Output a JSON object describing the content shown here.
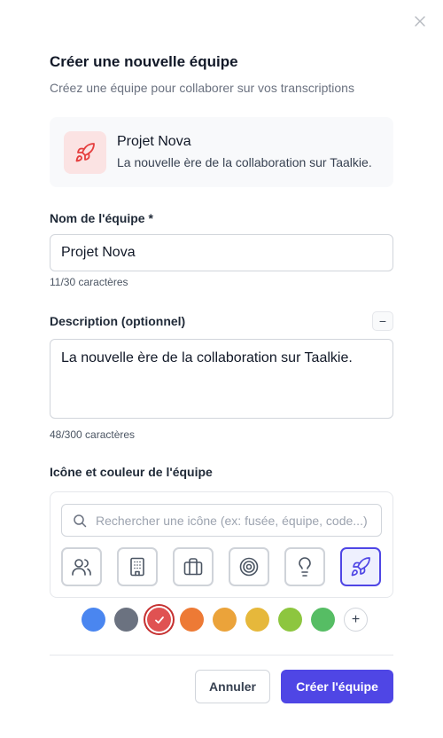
{
  "dialog": {
    "title": "Créer une nouvelle équipe",
    "subtitle": "Créez une équipe pour collaborer sur vos transcriptions"
  },
  "preview": {
    "name": "Projet Nova",
    "description": "La nouvelle ère de la collaboration sur Taalkie.",
    "icon": "rocket-icon",
    "icon_color": "#e53e3e",
    "icon_bg": "#fbe3e3"
  },
  "name_field": {
    "label": "Nom de l'équipe *",
    "value": "Projet Nova",
    "counter": "11/30 caractères"
  },
  "description_field": {
    "label": "Description (optionnel)",
    "collapse_label": "−",
    "value": "La nouvelle ère de la collaboration sur Taalkie.",
    "counter": "48/300 caractères"
  },
  "icon_section": {
    "label": "Icône et couleur de l'équipe",
    "search_placeholder": "Rechercher une icône (ex: fusée, équipe, code...)",
    "icons": [
      {
        "name": "users-icon",
        "selected": false
      },
      {
        "name": "building-icon",
        "selected": false
      },
      {
        "name": "briefcase-icon",
        "selected": false
      },
      {
        "name": "target-icon",
        "selected": false
      },
      {
        "name": "lightbulb-icon",
        "selected": false
      },
      {
        "name": "rocket-icon",
        "selected": true
      }
    ],
    "colors": [
      {
        "name": "blue",
        "hex": "#4a86f0",
        "selected": false
      },
      {
        "name": "gray",
        "hex": "#6b7280",
        "selected": false
      },
      {
        "name": "red",
        "hex": "#e05252",
        "selected": true
      },
      {
        "name": "orange",
        "hex": "#ed7a35",
        "selected": false
      },
      {
        "name": "amber",
        "hex": "#eba33a",
        "selected": false
      },
      {
        "name": "yellow",
        "hex": "#e6b83b",
        "selected": false
      },
      {
        "name": "lime",
        "hex": "#8dc63f",
        "selected": false
      },
      {
        "name": "green",
        "hex": "#56bd64",
        "selected": false
      }
    ],
    "add_color_label": "+"
  },
  "actions": {
    "cancel_label": "Annuler",
    "create_label": "Créer l'équipe"
  },
  "colors": {
    "accent": "#4f46e5",
    "selected_color": "#e05252"
  }
}
